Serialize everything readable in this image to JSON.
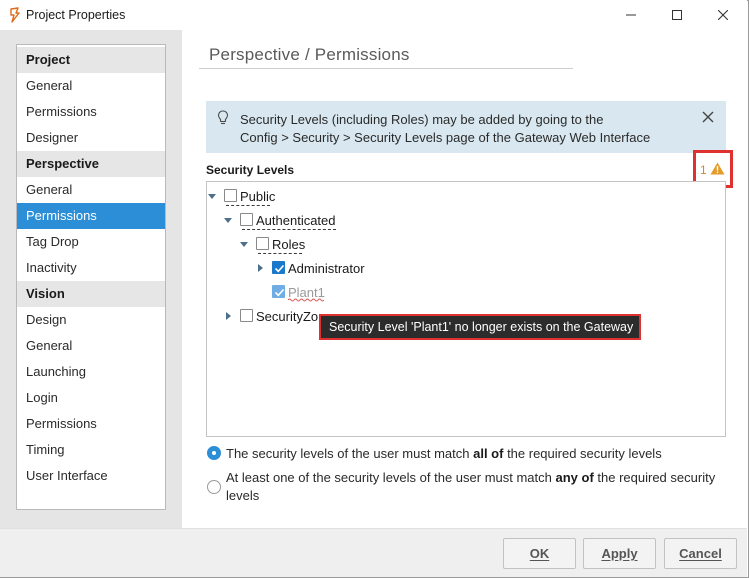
{
  "window": {
    "title": "Project Properties",
    "controls": {
      "minimize_icon": "minimize-icon",
      "maximize_icon": "maximize-icon",
      "close_icon": "close-icon"
    }
  },
  "sidebar": {
    "items": [
      {
        "label": "Project",
        "type": "header"
      },
      {
        "label": "General",
        "type": "item"
      },
      {
        "label": "Permissions",
        "type": "item"
      },
      {
        "label": "Designer",
        "type": "item"
      },
      {
        "label": "Perspective",
        "type": "header"
      },
      {
        "label": "General",
        "type": "item"
      },
      {
        "label": "Permissions",
        "type": "item",
        "selected": true
      },
      {
        "label": "Tag Drop",
        "type": "item"
      },
      {
        "label": "Inactivity",
        "type": "item"
      },
      {
        "label": "Vision",
        "type": "header"
      },
      {
        "label": "Design",
        "type": "item"
      },
      {
        "label": "General",
        "type": "item"
      },
      {
        "label": "Launching",
        "type": "item"
      },
      {
        "label": "Login",
        "type": "item"
      },
      {
        "label": "Permissions",
        "type": "item"
      },
      {
        "label": "Timing",
        "type": "item"
      },
      {
        "label": "User Interface",
        "type": "item"
      }
    ]
  },
  "main": {
    "page_title": "Perspective / Permissions",
    "info": {
      "line1": "Security Levels (including Roles) may be added by going to the",
      "line2": "Config > Security > Security Levels page of the Gateway Web Interface",
      "icon": "lightbulb-icon"
    },
    "security_levels_label": "Security Levels",
    "warning": {
      "count": "1",
      "icon": "warning-icon",
      "color": "#e59a2a"
    },
    "tree": [
      {
        "label": "Public",
        "checked": false,
        "expanded": true
      },
      {
        "label": "Authenticated",
        "checked": false,
        "expanded": true
      },
      {
        "label": "Roles",
        "checked": false,
        "expanded": true
      },
      {
        "label": "Administrator",
        "checked": true,
        "expanded": false
      },
      {
        "label": "Plant1",
        "checked": true,
        "missing": true
      },
      {
        "label": "SecurityZones",
        "checked": false,
        "expanded": false
      }
    ],
    "tooltip": "Security Level 'Plant1' no longer exists on the Gateway",
    "match_options": [
      {
        "prefix": "The security levels of the user must match ",
        "bold": "all of",
        "suffix": " the required security levels",
        "selected": true
      },
      {
        "prefix": "At least one of the security levels of the user must match ",
        "bold": "any of",
        "suffix": " the required security",
        "line2": "levels",
        "selected": false
      }
    ]
  },
  "footer": {
    "ok_label": "OK",
    "apply_label": "Apply",
    "cancel_label": "Cancel"
  },
  "colors": {
    "accent": "#2c8ed6",
    "highlight_border": "#e03131",
    "info_background": "#d9e8f0",
    "tooltip_background": "#2c2c2c"
  }
}
